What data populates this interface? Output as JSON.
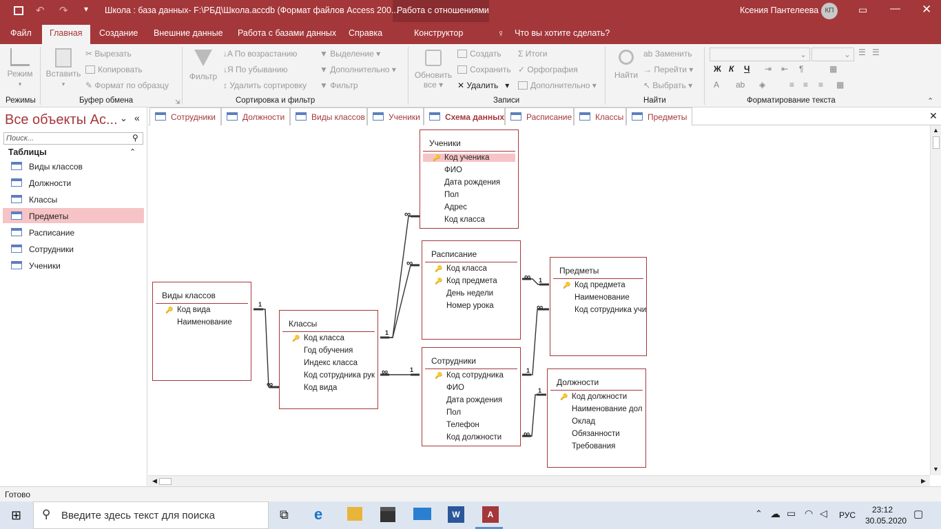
{
  "titlebar": {
    "title": "Школа : база данных- F:\\РБД\\Школа.accdb (Формат файлов Access 200...",
    "context": "Работа с отношениями",
    "user": "Ксения Пантелеева",
    "user_initials": "КП"
  },
  "ribbon_tabs": [
    "Файл",
    "Главная",
    "Создание",
    "Внешние данные",
    "Работа с базами данных",
    "Справка",
    "Конструктор"
  ],
  "tell_me": "Что вы хотите сделать?",
  "ribbon": {
    "mode": "Режим",
    "paste": "Вставить",
    "cut": "Вырезать",
    "copy": "Копировать",
    "format_painter": "Формат по образцу",
    "filter": "Фильтр",
    "asc": "По возрастанию",
    "desc": "По убыванию",
    "remove_sort": "Удалить сортировку",
    "selection": "Выделение",
    "advanced": "Дополнительно",
    "toggle_filter": "Фильтр",
    "refresh": "Обновить",
    "refresh2": "все",
    "create": "Создать",
    "save": "Сохранить",
    "delete": "Удалить",
    "totals": "Итоги",
    "spelling": "Орфография",
    "more": "Дополнительно",
    "find": "Найти",
    "replace": "Заменить",
    "goto": "Перейти",
    "select": "Выбрать",
    "bold": "Ж",
    "italic": "К",
    "underline": "Ч",
    "groups": [
      "Режимы",
      "Буфер обмена",
      "Сортировка и фильтр",
      "Записи",
      "Найти",
      "Форматирование текста"
    ]
  },
  "nav": {
    "title": "Все объекты Ac...",
    "search_placeholder": "Поиск...",
    "section": "Таблицы",
    "items": [
      "Виды классов",
      "Должности",
      "Классы",
      "Предметы",
      "Расписание",
      "Сотрудники",
      "Ученики"
    ],
    "selected": "Предметы"
  },
  "doc_tabs": [
    "Сотрудники",
    "Должности",
    "Виды классов",
    "Ученики",
    "Схема данных",
    "Расписание",
    "Классы",
    "Предметы"
  ],
  "active_tab": "Схема данных",
  "tables": {
    "uchen": {
      "name": "Ученики",
      "fields": [
        "Код ученика",
        "ФИО",
        "Дата рождения",
        "Пол",
        "Адрес",
        "Код класса"
      ]
    },
    "rasp": {
      "name": "Расписание",
      "fields": [
        "Код класса",
        "Код предмета",
        "День недели",
        "Номер урока"
      ]
    },
    "predm": {
      "name": "Предметы",
      "fields": [
        "Код предмета",
        "Наименование",
        "Код сотрудника учи"
      ]
    },
    "vidy": {
      "name": "Виды классов",
      "fields": [
        "Код вида",
        "Наименование"
      ]
    },
    "klassy": {
      "name": "Классы",
      "fields": [
        "Код класса",
        "Год обучения",
        "Индекс класса",
        "Код сотрудника рук",
        "Код вида"
      ]
    },
    "sotr": {
      "name": "Сотрудники",
      "fields": [
        "Код сотрудника",
        "ФИО",
        "Дата рождения",
        "Пол",
        "Телефон",
        "Код должности"
      ]
    },
    "dolzh": {
      "name": "Должности",
      "fields": [
        "Код должности",
        "Наименование дол",
        "Оклад",
        "Обязанности",
        "Требования"
      ]
    }
  },
  "rel_one": "1",
  "rel_many": "∞",
  "status": "Готово",
  "taskbar": {
    "search": "Введите здесь текст для поиска",
    "lang": "РУС",
    "time": "23:12",
    "date": "30.05.2020"
  },
  "colors": {
    "accent": "#a4373a",
    "selection": "#f6c4c6"
  }
}
